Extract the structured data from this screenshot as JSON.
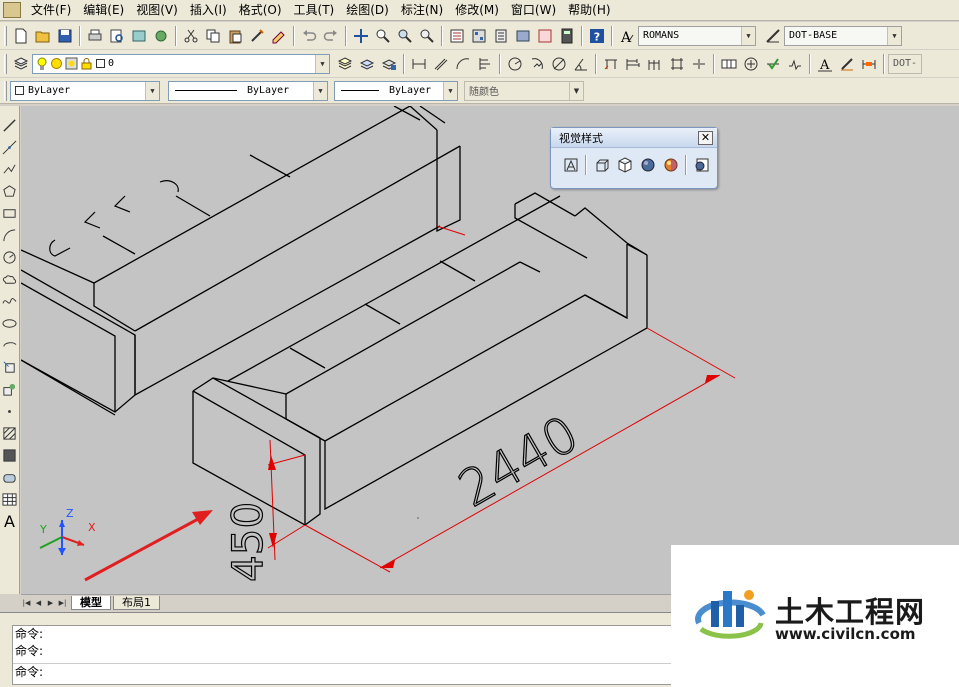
{
  "menu": {
    "items": [
      "文件(F)",
      "编辑(E)",
      "视图(V)",
      "插入(I)",
      "格式(O)",
      "工具(T)",
      "绘图(D)",
      "标注(N)",
      "修改(M)",
      "窗口(W)",
      "帮助(H)"
    ]
  },
  "toolbar": {
    "text_style": "ROMANS",
    "dim_style": "DOT-BASE",
    "dim_style_2": "DOT-",
    "layer": "0",
    "color": "ByLayer",
    "linetype": "ByLayer",
    "lineweight": "ByLayer",
    "plotstyle": "随颜色"
  },
  "visual_styles_panel": {
    "title": "视觉样式",
    "close": "✕"
  },
  "drawing": {
    "dimension_length": "2440",
    "dimension_height": "450",
    "dimension_partial": "2440",
    "ucs_x": "X",
    "ucs_y": "Y",
    "ucs_z": "Z",
    "colors": {
      "background": "#c4c4c4",
      "line": "#000000",
      "dimension": "#e00000",
      "arrow": "#e02020"
    }
  },
  "tabs": {
    "model": "模型",
    "layout1": "布局1"
  },
  "command": {
    "lines": [
      "命令:",
      "命令:"
    ],
    "prompt": "命令:"
  },
  "watermark": {
    "name": "土木工程网",
    "url": "www.civilcn.com"
  }
}
